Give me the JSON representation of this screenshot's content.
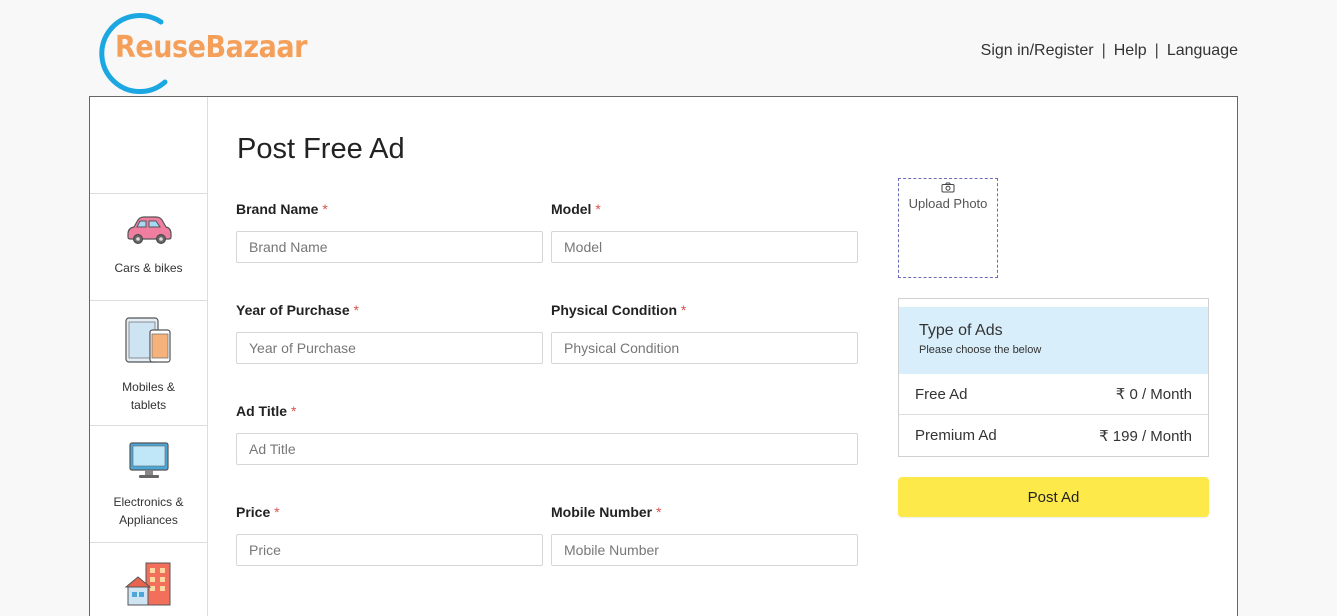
{
  "brand": {
    "name": "ReuseBazaar",
    "ring_color": "#1ba7e2",
    "text_color": "#f5a05a"
  },
  "nav": {
    "signin": "Sign in/Register",
    "sep": "|",
    "help": "Help",
    "language": "Language"
  },
  "sidebar": {
    "categories": [
      {
        "label": "Cars & bikes",
        "icon": "car-icon"
      },
      {
        "label": "Mobiles & tablets",
        "icon": "mobile-tablet-icon"
      },
      {
        "label": "Electronics & Appliances",
        "icon": "monitor-icon"
      },
      {
        "label": "",
        "icon": "buildings-icon"
      }
    ]
  },
  "form": {
    "title": "Post Free Ad",
    "required_mark": "*",
    "brand_name": {
      "label": "Brand Name",
      "placeholder": "Brand Name"
    },
    "model": {
      "label": "Model",
      "placeholder": "Model"
    },
    "year": {
      "label": "Year of Purchase",
      "placeholder": "Year of Purchase"
    },
    "condition": {
      "label": "Physical Condition",
      "placeholder": "Physical Condition"
    },
    "ad_title": {
      "label": "Ad Title",
      "placeholder": "Ad Title"
    },
    "price": {
      "label": "Price",
      "placeholder": "Price"
    },
    "mobile": {
      "label": "Mobile Number",
      "placeholder": "Mobile Number"
    }
  },
  "upload": {
    "label": "Upload Photo",
    "icon": "camera-icon"
  },
  "ad_types": {
    "heading": "Type of Ads",
    "subheading": "Please choose the below",
    "options": [
      {
        "name": "Free Ad",
        "price": "₹ 0 / Month"
      },
      {
        "name": "Premium Ad",
        "price": "₹ 199 / Month"
      }
    ],
    "header_bg": "#d8eefa"
  },
  "post_button": {
    "label": "Post Ad",
    "color": "#fde94a"
  }
}
